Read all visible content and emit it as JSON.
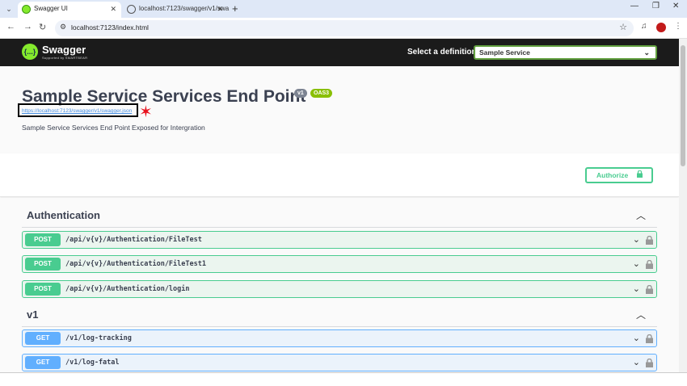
{
  "browser": {
    "tabs": [
      {
        "title": "Swagger UI",
        "active": true
      },
      {
        "title": "localhost:7123/swagger/v1/swa",
        "active": false
      }
    ],
    "url": "localhost:7123/index.html"
  },
  "topbar": {
    "logo_text": "Swagger",
    "logo_sub": "Supported by SMARTBEAR",
    "logo_glyph": "{...}",
    "definition_label": "Select a definition",
    "definition_selected": "Sample Service"
  },
  "info": {
    "title": "Sample Service Services End Point",
    "version_badge": "v1",
    "oas_badge": "OAS3",
    "spec_url": "https://localhost:7123/swagger/v1/swagger.json",
    "description": "Sample Service Services End Point Exposed for Intergration"
  },
  "authorize": {
    "label": "Authorize"
  },
  "tags": [
    {
      "name": "Authentication",
      "operations": [
        {
          "method": "POST",
          "path": "/api/v{v}/Authentication/FileTest"
        },
        {
          "method": "POST",
          "path": "/api/v{v}/Authentication/FileTest1"
        },
        {
          "method": "POST",
          "path": "/api/v{v}/Authentication/login"
        }
      ]
    },
    {
      "name": "v1",
      "operations": [
        {
          "method": "GET",
          "path": "/v1/log-tracking"
        },
        {
          "method": "GET",
          "path": "/v1/log-fatal"
        }
      ]
    }
  ],
  "colors": {
    "post": "#49cc90",
    "get": "#61affe",
    "topbar": "#1b1b1b",
    "marker": "#e8111e"
  }
}
